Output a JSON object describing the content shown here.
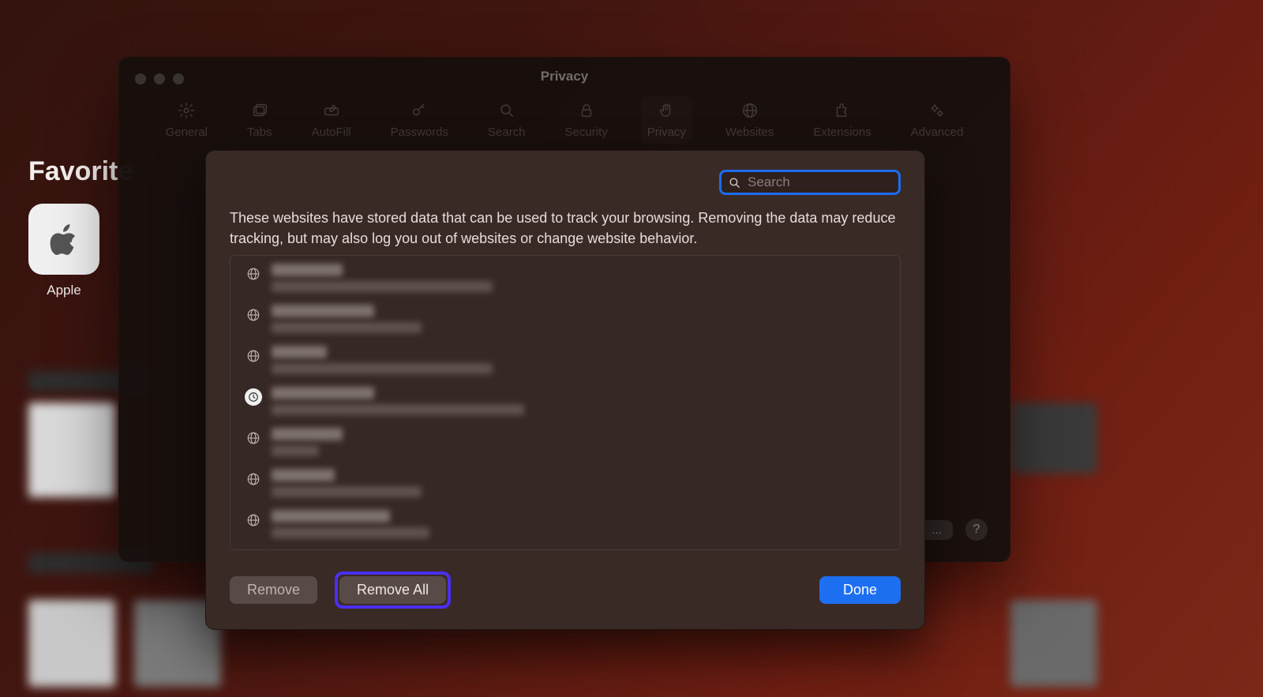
{
  "behind": {
    "favorites_heading": "Favorite",
    "tile_label": "Apple"
  },
  "prefs": {
    "title": "Privacy",
    "tabs": [
      {
        "label": "General",
        "icon": "gear"
      },
      {
        "label": "Tabs",
        "icon": "tabs"
      },
      {
        "label": "AutoFill",
        "icon": "pencil"
      },
      {
        "label": "Passwords",
        "icon": "key"
      },
      {
        "label": "Search",
        "icon": "search"
      },
      {
        "label": "Security",
        "icon": "lock"
      },
      {
        "label": "Privacy",
        "icon": "hand",
        "selected": true
      },
      {
        "label": "Websites",
        "icon": "globe"
      },
      {
        "label": "Extensions",
        "icon": "puzzle"
      },
      {
        "label": "Advanced",
        "icon": "gears"
      }
    ],
    "footer_more": "...",
    "footer_help": "?"
  },
  "sheet": {
    "search_placeholder": "Search",
    "description": "These websites have stored data that can be used to track your browsing. Removing the data may reduce tracking, but may also log you out of websites or change website behavior.",
    "rows": [
      {
        "icon": "globe",
        "w1": 90,
        "w2": 280
      },
      {
        "icon": "globe",
        "w1": 130,
        "w2": 190
      },
      {
        "icon": "globe",
        "w1": 70,
        "w2": 280
      },
      {
        "icon": "clock",
        "w1": 130,
        "w2": 320
      },
      {
        "icon": "globe",
        "w1": 90,
        "w2": 60
      },
      {
        "icon": "globe",
        "w1": 80,
        "w2": 190
      },
      {
        "icon": "globe",
        "w1": 150,
        "w2": 200
      }
    ],
    "buttons": {
      "remove": "Remove",
      "remove_all": "Remove All",
      "done": "Done"
    }
  }
}
